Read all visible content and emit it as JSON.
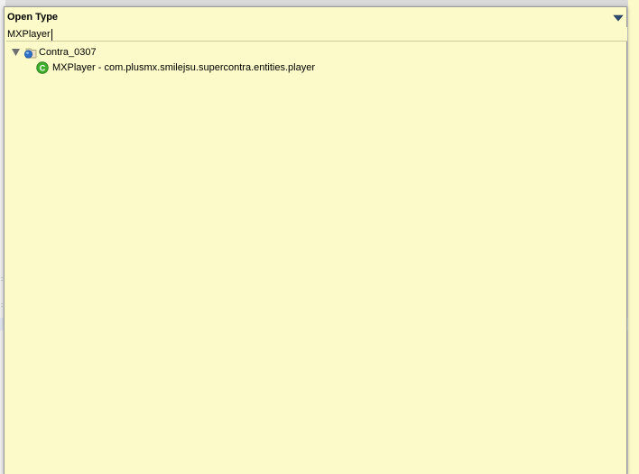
{
  "popup": {
    "title": "Open Type",
    "menu_icon": "view-menu-triangle-icon"
  },
  "search": {
    "value": "MXPlayer"
  },
  "tree": {
    "project": {
      "label": "Contra_0307",
      "expanded": true,
      "icon": "java-project-icon"
    },
    "types": [
      {
        "label": "MXPlayer - com.plusmx.smilejsu.supercontra.entities.player",
        "icon": "class-icon"
      }
    ]
  },
  "colors": {
    "popup_background": "#fbfac8",
    "class_icon_green": "#3fae2a",
    "project_icon_blue": "#2f6fc6"
  }
}
